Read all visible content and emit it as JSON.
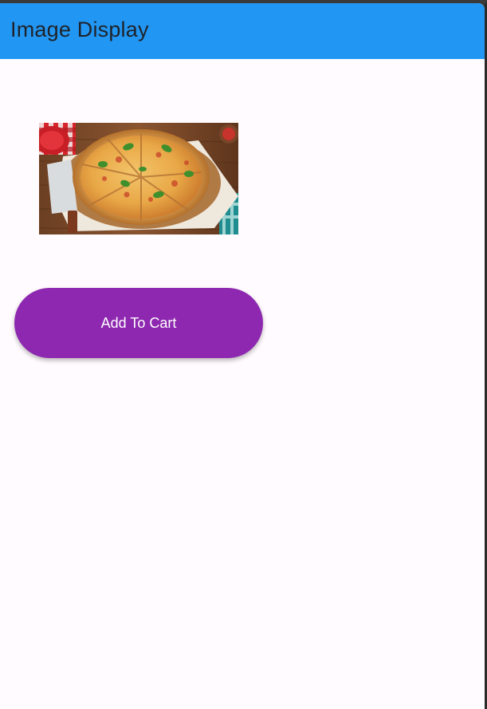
{
  "app": {
    "title": "Image Display"
  },
  "image": {
    "alt": "pizza-photo",
    "subject": "pizza"
  },
  "actions": {
    "add_to_cart_label": "Add To Cart"
  },
  "colors": {
    "appbar": "#2196f3",
    "button": "#8e28b0",
    "background": "#fffbfe"
  }
}
